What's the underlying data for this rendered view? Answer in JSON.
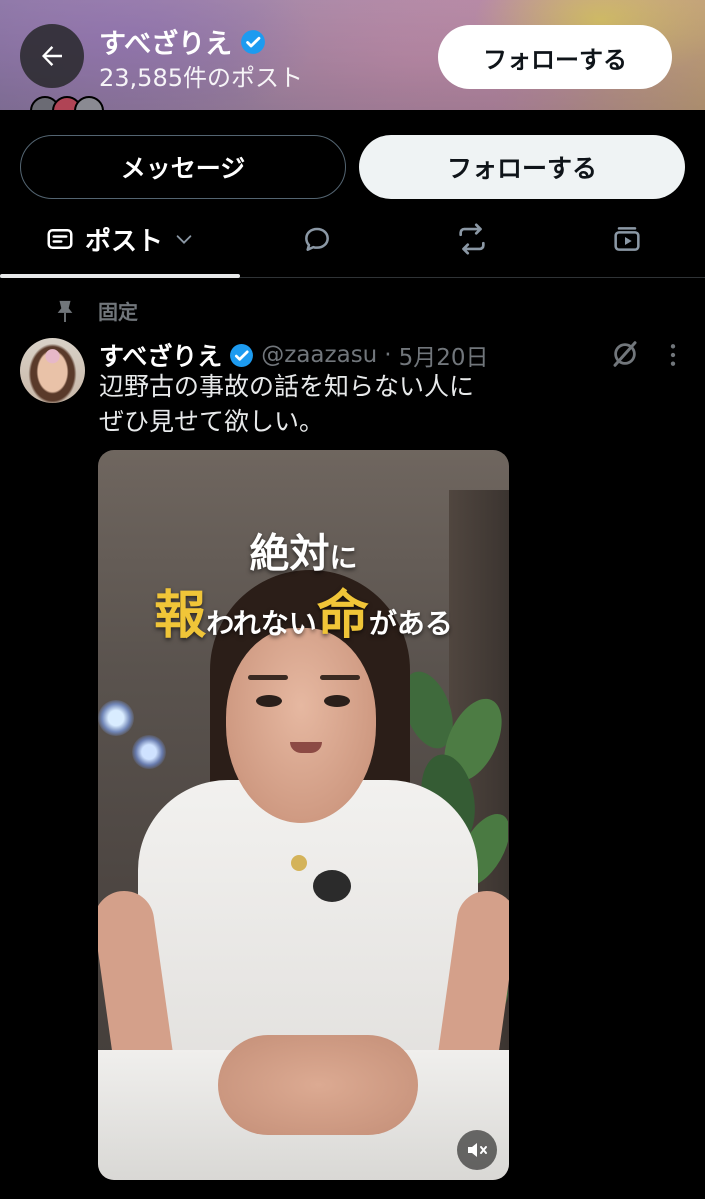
{
  "header": {
    "name": "すべざりえ",
    "post_count": "23,585件のポスト",
    "follow_label": "フォローする"
  },
  "actions": {
    "message_label": "メッセージ",
    "follow_label": "フォローする"
  },
  "tabs": {
    "posts_label": "ポスト",
    "active": "posts",
    "items": [
      "posts-icon",
      "replies-icon",
      "reposts-icon",
      "media-icon"
    ]
  },
  "pinned_post": {
    "pinned_label": "固定",
    "author_name": "すべざりえ",
    "handle": "@zaazasu",
    "separator": "·",
    "date": "5月20日",
    "text_line1": "辺野古の事故の話を知らない人に",
    "text_line2": "ぜひ見せて欲しい。",
    "video_caption": {
      "line1_a": "絶対",
      "line1_b": "に",
      "line2_a": "報",
      "line2_b": "われない",
      "line2_c": "命",
      "line2_d": "がある"
    }
  },
  "colors": {
    "background": "#000000",
    "verified": "#1d9bf0",
    "secondary_text": "#71767b",
    "caption_gold": "#f0c538"
  }
}
